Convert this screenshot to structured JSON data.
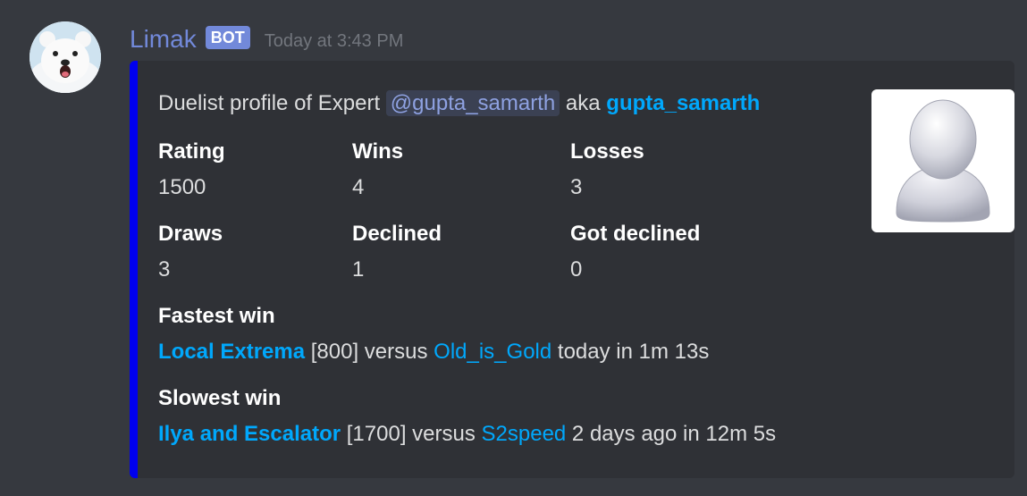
{
  "message": {
    "author": "Limak",
    "bot_tag": "BOT",
    "timestamp": "Today at 3:43 PM",
    "avatar_icon": "polar-bear-avatar"
  },
  "embed": {
    "accent_color": "#0000ee",
    "description": {
      "prefix": "Duelist profile of Expert ",
      "mention": "@gupta_samarth",
      "middle": " aka ",
      "handle": "gupta_samarth"
    },
    "thumbnail_icon": "default-user-icon",
    "fields": [
      {
        "name": "Rating",
        "value": "1500"
      },
      {
        "name": "Wins",
        "value": "4"
      },
      {
        "name": "Losses",
        "value": "3"
      },
      {
        "name": "Draws",
        "value": "3"
      },
      {
        "name": "Declined",
        "value": "1"
      },
      {
        "name": "Got declined",
        "value": "0"
      }
    ],
    "fastest_win": {
      "name": "Fastest win",
      "problem": "Local Extrema",
      "rating": " [800] versus ",
      "opponent": "Old_is_Gold",
      "detail": " today in 1m 13s"
    },
    "slowest_win": {
      "name": "Slowest win",
      "problem": "Ilya and Escalator",
      "rating": " [1700] versus ",
      "opponent": "S2speed",
      "detail": " 2 days ago in 12m 5s"
    }
  }
}
